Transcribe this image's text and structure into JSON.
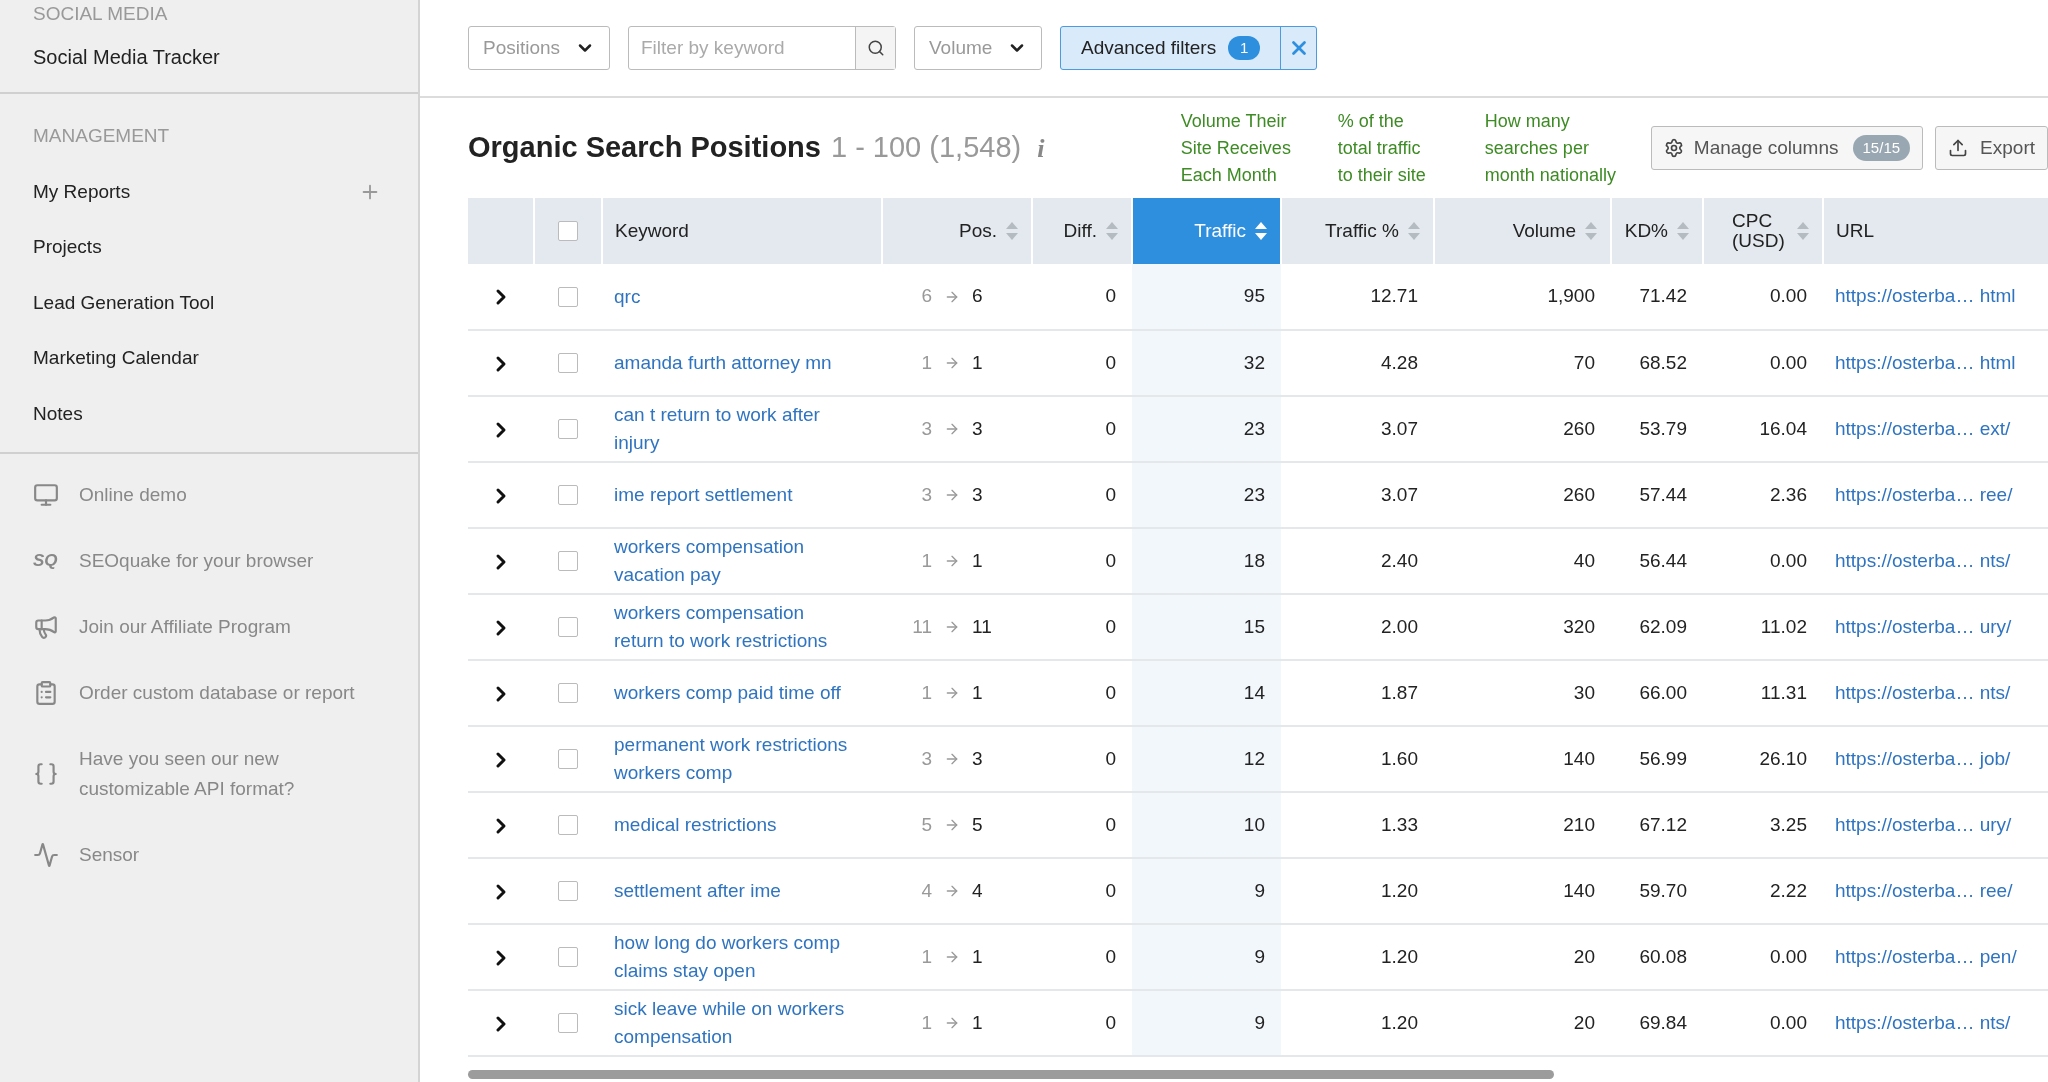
{
  "sidebar": {
    "social_title": "SOCIAL MEDIA",
    "social_items": [
      {
        "label": "Social Media Tracker"
      }
    ],
    "management_title": "MANAGEMENT",
    "management_items": [
      {
        "label": "My Reports",
        "addable": true
      },
      {
        "label": "Projects",
        "addable": false
      },
      {
        "label": "Lead Generation Tool",
        "addable": false
      },
      {
        "label": "Marketing Calendar",
        "addable": false
      },
      {
        "label": "Notes",
        "addable": false
      }
    ],
    "extras": [
      {
        "kind": "demo",
        "label": "Online demo"
      },
      {
        "kind": "logo",
        "icon_text": "SQ",
        "label": "SEOquake for your browser"
      },
      {
        "kind": "megaphone",
        "label": "Join our Affiliate Program"
      },
      {
        "kind": "clipboard",
        "label": "Order custom database or report"
      },
      {
        "kind": "braces",
        "label": "Have you seen our new customizable API format?"
      },
      {
        "kind": "pulse",
        "label": "Sensor"
      }
    ]
  },
  "toolbar": {
    "positions": "Positions",
    "search": {
      "placeholder": "Filter by keyword"
    },
    "volume": "Volume",
    "advanced": {
      "label": "Advanced filters",
      "count": "1"
    }
  },
  "header": {
    "title": "Organic Search Positions",
    "range": "1 - 100 (1,548)",
    "info": "i",
    "notes": [
      "Volume Their\nSite Receives\nEach Month",
      "% of the\ntotal traffic\nto their site",
      "How many\nsearches per\nmonth nationally"
    ],
    "manage": {
      "label": "Manage columns",
      "count": "15/15"
    },
    "export": "Export"
  },
  "table": {
    "all_checked": false,
    "columns": [
      {
        "label": "Keyword",
        "sortable": false,
        "selected": false
      },
      {
        "label": "Pos.",
        "sortable": true,
        "selected": false
      },
      {
        "label": "Diff.",
        "sortable": true,
        "selected": false
      },
      {
        "label": "Traffic",
        "sortable": true,
        "selected": true
      },
      {
        "label": "Traffic %",
        "sortable": true,
        "selected": false
      },
      {
        "label": "Volume",
        "sortable": true,
        "selected": false
      },
      {
        "label": "KD%",
        "sortable": true,
        "selected": false
      },
      {
        "label": "CPC (USD)",
        "sortable": true,
        "selected": false
      },
      {
        "label": "URL",
        "sortable": false,
        "selected": false
      }
    ],
    "rows": [
      {
        "expanded": false,
        "checked": false,
        "keyword": "qrc",
        "pos_from": "6",
        "pos_to": "6",
        "diff": "0",
        "traffic": "95",
        "traffic_pct": "12.71",
        "volume": "1,900",
        "kd": "71.42",
        "cpc": "0.00",
        "url": "https://osterba… html"
      },
      {
        "expanded": false,
        "checked": false,
        "keyword": "amanda furth attorney mn",
        "pos_from": "1",
        "pos_to": "1",
        "diff": "0",
        "traffic": "32",
        "traffic_pct": "4.28",
        "volume": "70",
        "kd": "68.52",
        "cpc": "0.00",
        "url": "https://osterba… html"
      },
      {
        "expanded": false,
        "checked": false,
        "keyword": "can t return to work after injury",
        "pos_from": "3",
        "pos_to": "3",
        "diff": "0",
        "traffic": "23",
        "traffic_pct": "3.07",
        "volume": "260",
        "kd": "53.79",
        "cpc": "16.04",
        "url": "https://osterba… ext/"
      },
      {
        "expanded": false,
        "checked": false,
        "keyword": "ime report settlement",
        "pos_from": "3",
        "pos_to": "3",
        "diff": "0",
        "traffic": "23",
        "traffic_pct": "3.07",
        "volume": "260",
        "kd": "57.44",
        "cpc": "2.36",
        "url": "https://osterba… ree/"
      },
      {
        "expanded": false,
        "checked": false,
        "keyword": "workers compensation vacation pay",
        "pos_from": "1",
        "pos_to": "1",
        "diff": "0",
        "traffic": "18",
        "traffic_pct": "2.40",
        "volume": "40",
        "kd": "56.44",
        "cpc": "0.00",
        "url": "https://osterba… nts/"
      },
      {
        "expanded": false,
        "checked": false,
        "keyword": "workers compensation return to work restrictions",
        "pos_from": "11",
        "pos_to": "11",
        "diff": "0",
        "traffic": "15",
        "traffic_pct": "2.00",
        "volume": "320",
        "kd": "62.09",
        "cpc": "11.02",
        "url": "https://osterba… ury/"
      },
      {
        "expanded": false,
        "checked": false,
        "keyword": "workers comp paid time off",
        "pos_from": "1",
        "pos_to": "1",
        "diff": "0",
        "traffic": "14",
        "traffic_pct": "1.87",
        "volume": "30",
        "kd": "66.00",
        "cpc": "11.31",
        "url": "https://osterba… nts/"
      },
      {
        "expanded": false,
        "checked": false,
        "keyword": "permanent work restrictions workers comp",
        "pos_from": "3",
        "pos_to": "3",
        "diff": "0",
        "traffic": "12",
        "traffic_pct": "1.60",
        "volume": "140",
        "kd": "56.99",
        "cpc": "26.10",
        "url": "https://osterba… job/"
      },
      {
        "expanded": false,
        "checked": false,
        "keyword": "medical restrictions",
        "pos_from": "5",
        "pos_to": "5",
        "diff": "0",
        "traffic": "10",
        "traffic_pct": "1.33",
        "volume": "210",
        "kd": "67.12",
        "cpc": "3.25",
        "url": "https://osterba… ury/"
      },
      {
        "expanded": false,
        "checked": false,
        "keyword": "settlement after ime",
        "pos_from": "4",
        "pos_to": "4",
        "diff": "0",
        "traffic": "9",
        "traffic_pct": "1.20",
        "volume": "140",
        "kd": "59.70",
        "cpc": "2.22",
        "url": "https://osterba… ree/"
      },
      {
        "expanded": false,
        "checked": false,
        "keyword": "how long do workers comp claims stay open",
        "pos_from": "1",
        "pos_to": "1",
        "diff": "0",
        "traffic": "9",
        "traffic_pct": "1.20",
        "volume": "20",
        "kd": "60.08",
        "cpc": "0.00",
        "url": "https://osterba… pen/"
      },
      {
        "expanded": false,
        "checked": false,
        "keyword": "sick leave while on workers compensation",
        "pos_from": "1",
        "pos_to": "1",
        "diff": "0",
        "traffic": "9",
        "traffic_pct": "1.20",
        "volume": "20",
        "kd": "69.84",
        "cpc": "0.00",
        "url": "https://osterba… nts/"
      }
    ]
  }
}
